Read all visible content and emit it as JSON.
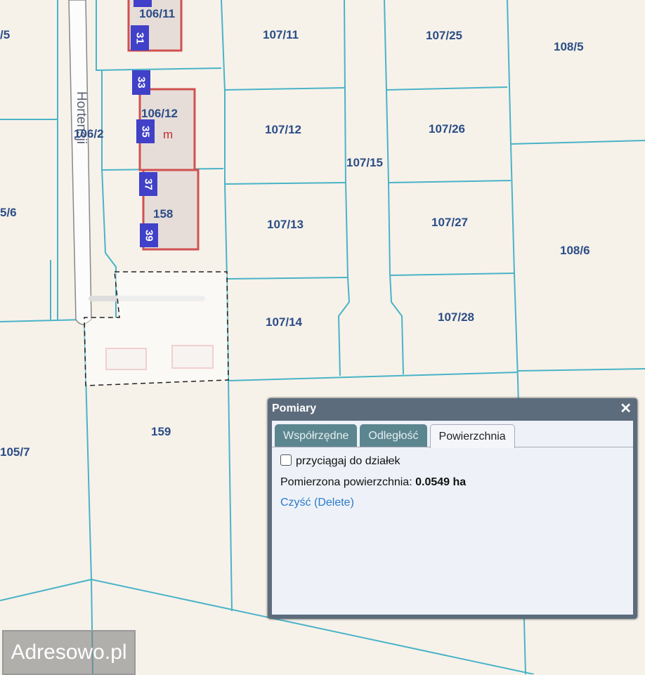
{
  "map": {
    "street": "Hortensji",
    "parcels": [
      "106/11",
      "107/11",
      "107/25",
      "108/5",
      "/5",
      "106/12",
      "106/2",
      "107/12",
      "107/26",
      "107/15",
      "5/6",
      "158",
      "107/13",
      "107/27",
      "108/6",
      "107/14",
      "107/28",
      "159",
      "105/7"
    ],
    "house_numbers": [
      "31",
      "33",
      "35",
      "37",
      "39"
    ],
    "building_marker": "m",
    "colors": {
      "background": "#f6f2ea",
      "parcel_line": "#4ab3c7",
      "building": "#d05050",
      "label": "#2c4d86",
      "house_number": "#4040c8"
    }
  },
  "dialog": {
    "title": "Pomiary",
    "close": "✕",
    "tabs": [
      {
        "label": "Współrzędne",
        "active": false
      },
      {
        "label": "Odległość",
        "active": false
      },
      {
        "label": "Powierzchnia",
        "active": true
      }
    ],
    "snap_label": "przyciągaj do działek",
    "snap_checked": false,
    "measured_label": "Pomierzona powierzchnia:",
    "measured_value": "0.0549 ha",
    "clear_link": "Czyść (Delete)"
  },
  "watermark": "Adresowo.pl"
}
